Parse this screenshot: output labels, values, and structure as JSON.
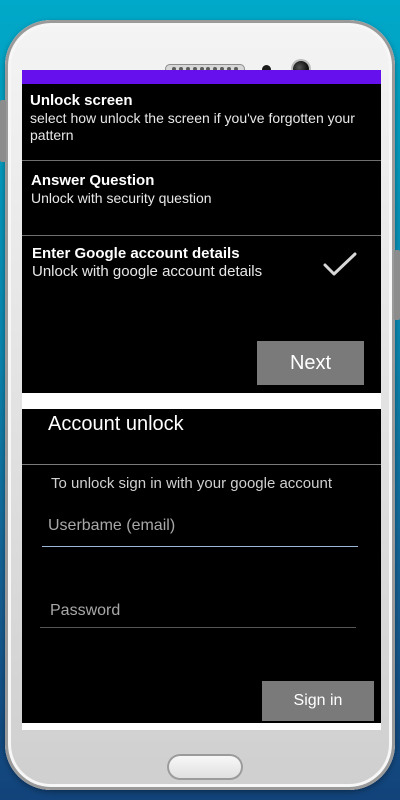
{
  "options": [
    {
      "title": "Unlock screen",
      "desc": "select how unlock the screen if you've forgotten your pattern",
      "checked": false
    },
    {
      "title": "Answer Question",
      "desc": "Unlock with security question",
      "checked": false
    },
    {
      "title": "Enter Google account details",
      "desc": "Unlock with google account details",
      "checked": true
    }
  ],
  "next_label": "Next",
  "account": {
    "title": "Account unlock",
    "hint": "To unlock sign in with your google account",
    "username_placeholder": "Userbame (email)",
    "password_placeholder": "Password",
    "signin_label": "Sign in"
  },
  "colors": {
    "status_bar": "#6610ee",
    "panel_bg": "#000000",
    "button_bg": "#7a7a7a",
    "focused_underline": "#9bb8d8"
  }
}
